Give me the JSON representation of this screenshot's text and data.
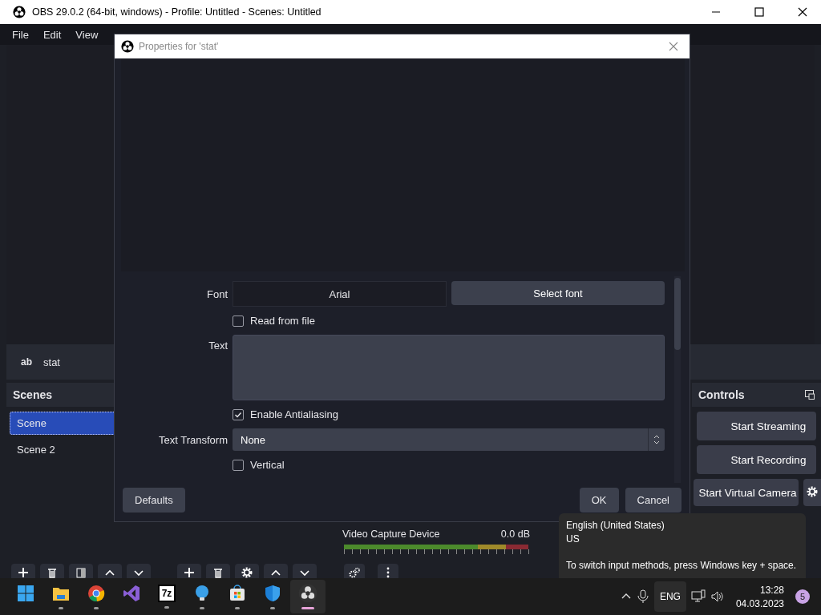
{
  "window": {
    "title": "OBS 29.0.2 (64-bit, windows) - Profile: Untitled - Scenes: Untitled"
  },
  "menu": [
    "File",
    "Edit",
    "View"
  ],
  "source_bar": {
    "icon": "ab",
    "name": "stat"
  },
  "scenes": {
    "title": "Scenes",
    "items": [
      {
        "label": "Scene",
        "selected": true
      },
      {
        "label": "Scene 2",
        "selected": false
      }
    ]
  },
  "mixer": {
    "channels": [
      {
        "name": "Video Capture Device",
        "reading": "0.0 dB"
      }
    ]
  },
  "controls": {
    "title": "Controls",
    "buttons": [
      "Start Streaming",
      "Start Recording",
      "Start Virtual Camera"
    ]
  },
  "dialog": {
    "title": "Properties for 'stat'",
    "fields": [
      {
        "kind": "font",
        "label": "Font",
        "value": "Arial",
        "button": "Select font"
      },
      {
        "kind": "checkbox",
        "label": "Read from file",
        "checked": false
      },
      {
        "kind": "textarea",
        "label": "Text"
      },
      {
        "kind": "checkbox",
        "label": "Enable Antialiasing",
        "checked": true
      },
      {
        "kind": "select",
        "label": "Text Transform",
        "value": "None"
      },
      {
        "kind": "checkbox",
        "label": "Vertical",
        "checked": false
      }
    ],
    "defaults": "Defaults",
    "ok": "OK",
    "cancel": "Cancel"
  },
  "tooltip": {
    "lines": [
      "English (United States)",
      "US",
      "To switch input methods, press Windows key + space."
    ]
  },
  "taskbar": {
    "apps": [
      {
        "kind": "start",
        "running": false,
        "selected": false
      },
      {
        "kind": "folder",
        "running": true,
        "selected": false
      },
      {
        "kind": "chrome",
        "running": true,
        "selected": false
      },
      {
        "kind": "vs",
        "running": false,
        "selected": false
      },
      {
        "kind": "archive",
        "label": "7z",
        "running": true,
        "selected": false
      },
      {
        "kind": "bulb",
        "running": true,
        "selected": false
      },
      {
        "kind": "store",
        "running": true,
        "selected": false
      },
      {
        "kind": "shield",
        "running": true,
        "selected": false
      },
      {
        "kind": "obs",
        "running": true,
        "selected": true
      }
    ],
    "language": "ENG",
    "time": "13:28",
    "date": "04.03.2023",
    "notifications": "5"
  }
}
